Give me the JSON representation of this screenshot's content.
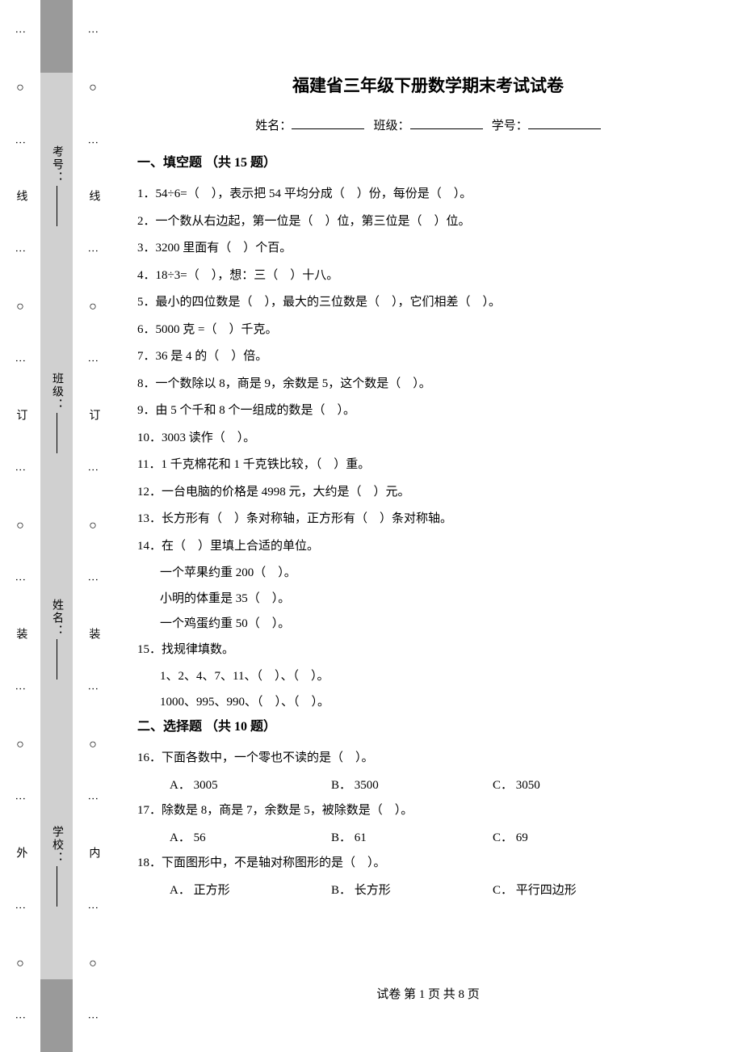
{
  "title": "福建省三年级下册数学期末考试试卷",
  "info": {
    "name_label": "姓名：",
    "class_label": "班级：",
    "id_label": "学号："
  },
  "section1": {
    "heading": "一、填空题 （共 15 题）"
  },
  "section2": {
    "heading": "二、选择题 （共 10 题）"
  },
  "q": {
    "1": "1．54÷6=（　），表示把 54 平均分成（　）份，每份是（　）。",
    "2": "2．一个数从右边起，第一位是（　）位，第三位是（　）位。",
    "3": "3．3200 里面有（　）个百。",
    "4": "4．18÷3=（　），想：三（　）十八。",
    "5": "5．最小的四位数是（　），最大的三位数是（　），它们相差（　）。",
    "6": "6．5000 克 =（　）千克。",
    "7": "7．36 是 4 的（　）倍。",
    "8": "8．一个数除以 8，商是 9，余数是 5，这个数是（　）。",
    "9": "9．由 5 个千和 8 个一组成的数是（　）。",
    "10": "10．3003 读作（　）。",
    "11": "11．1 千克棉花和 1 千克铁比较，（　）重。",
    "12": "12．一台电脑的价格是 4998 元，大约是（　）元。",
    "13": "13．长方形有（　）条对称轴，正方形有（　）条对称轴。",
    "14": "14．在（　）里填上合适的单位。",
    "14a": "一个苹果约重 200（　）。",
    "14b": "小明的体重是 35（　）。",
    "14c": "一个鸡蛋约重 50（　）。",
    "15": "15．找规律填数。",
    "15a": "1、2、4、7、11、（　）、（　）。",
    "15b": "1000、995、990、（　）、（　）。",
    "16": "16．下面各数中，一个零也不读的是（　）。",
    "16A": "A． 3005",
    "16B": "B． 3500",
    "16C": "C． 3050",
    "17": "17．除数是 8，商是 7，余数是 5，被除数是（　）。",
    "17A": "A． 56",
    "17B": "B． 61",
    "17C": "C． 69",
    "18": "18．下面图形中，不是轴对称图形的是（　）。",
    "18A": "A． 正方形",
    "18B": "B． 长方形",
    "18C": "C． 平行四边形"
  },
  "footer": "试卷 第 1 页 共 8 页",
  "binding": {
    "outer_char": "外",
    "inner_char": "内",
    "zhuang": "装",
    "ding": "订",
    "xian": "线",
    "school": "学校：",
    "name": "姓名：",
    "class": "班级：",
    "examno": "考号："
  }
}
